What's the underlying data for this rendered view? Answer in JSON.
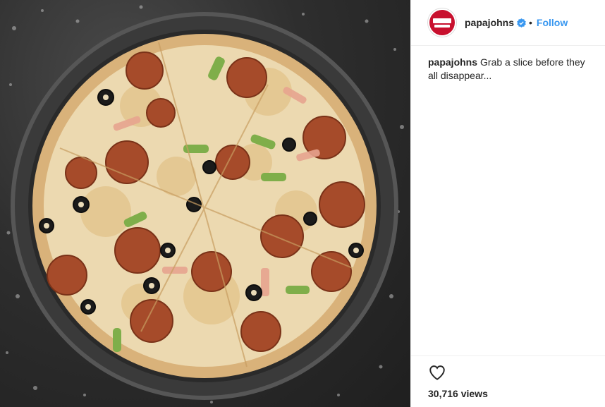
{
  "post": {
    "username": "papajohns",
    "separator": "•",
    "follow_label": "Follow",
    "caption_user": "papajohns",
    "caption_text": "Grab a slice before they all disappear...",
    "views_count": "30,716",
    "views_suffix": "views"
  },
  "colors": {
    "accent": "#3897f0",
    "brand_red": "#c8102e",
    "text": "#262626"
  },
  "icons": [
    "verified-badge-icon",
    "heart-icon",
    "papajohns-logo"
  ],
  "media": {
    "subject": "pizza"
  }
}
